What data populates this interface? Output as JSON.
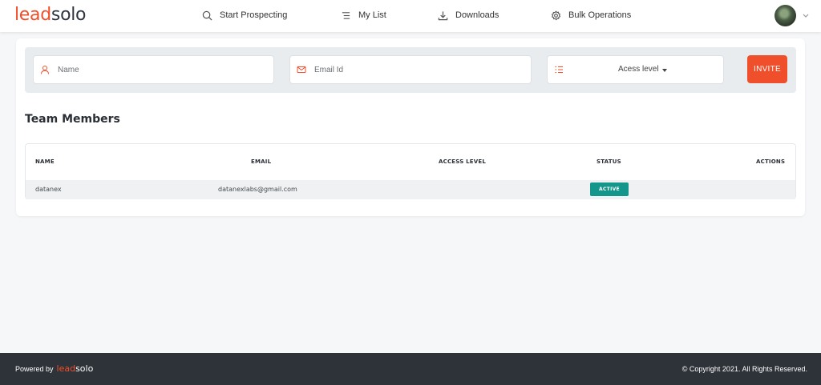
{
  "header": {
    "logo_part1": "lead",
    "logo_part2": "solo",
    "nav": [
      {
        "label": "Start Prospecting",
        "icon": "search-icon"
      },
      {
        "label": "My List",
        "icon": "list-icon"
      },
      {
        "label": "Downloads",
        "icon": "download-icon"
      },
      {
        "label": "Bulk Operations",
        "icon": "gear-icon"
      }
    ]
  },
  "invite": {
    "name_placeholder": "Name",
    "email_placeholder": "Email Id",
    "access_label": "Acess level",
    "invite_label": "INVITE"
  },
  "team": {
    "title": "Team Members",
    "columns": [
      "NAME",
      "EMAIL",
      "ACCESS LEVEL",
      "STATUS",
      "ACTIONS"
    ],
    "rows": [
      {
        "name": "datanex",
        "email": "datanexlabs@gmail.com",
        "access": "",
        "status": "ACTIVE"
      }
    ]
  },
  "footer": {
    "powered_by": "Powered by",
    "logo_part1": "lead",
    "logo_part2": "solo",
    "copyright": "© Copyright 2021. All Rights Reserved."
  },
  "colors": {
    "brand": "#f04f2b",
    "dark": "#2e3239",
    "status_active": "#14968a"
  }
}
